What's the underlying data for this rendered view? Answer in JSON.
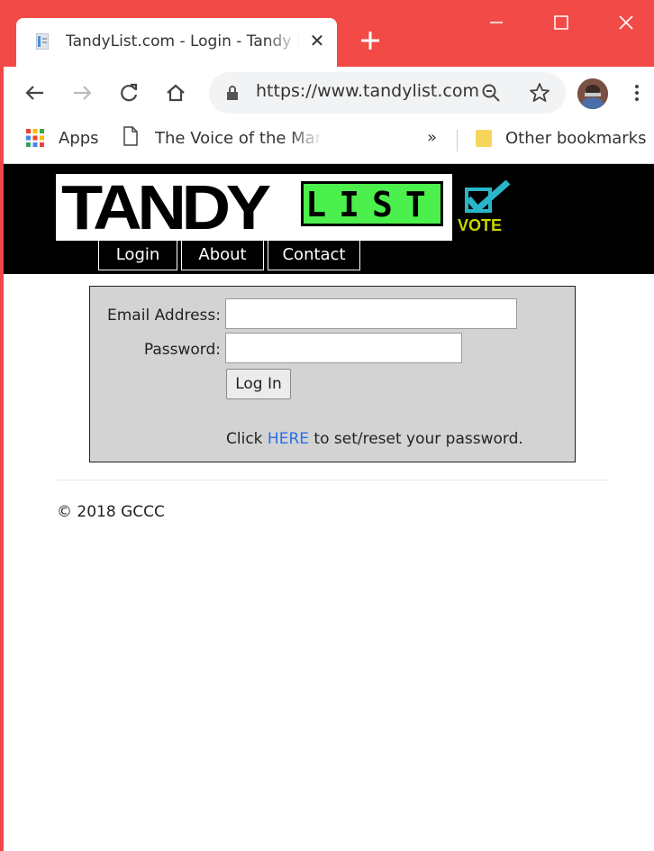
{
  "browser": {
    "tab_title": "TandyList.com - Login - Tandy List",
    "tab_close": "✕",
    "new_tab": "+",
    "url": "https://www.tandylist.com",
    "theme_color": "#f24a46"
  },
  "bookmarks": {
    "apps": "Apps",
    "voice": "The Voice of the Martyrs",
    "more": "»",
    "other": "Other bookmarks"
  },
  "site": {
    "logo": {
      "tandy": "TANDY",
      "list": "LIST",
      "vote": "VOTE",
      "list_color": "#4cf04c",
      "vote_color": "#c8d600",
      "check_color": "#29b6c9"
    },
    "menu": [
      "Login",
      "About",
      "Contact"
    ]
  },
  "login": {
    "email_label": "Email Address:",
    "email_value": "",
    "password_label": "Password:",
    "password_value": "",
    "submit_label": "Log In",
    "reset_prefix": "Click ",
    "reset_link": "HERE",
    "reset_suffix": " to set/reset your password.",
    "link_color": "#2a6ee8"
  },
  "footer": {
    "copyright": "© 2018 GCCC"
  }
}
